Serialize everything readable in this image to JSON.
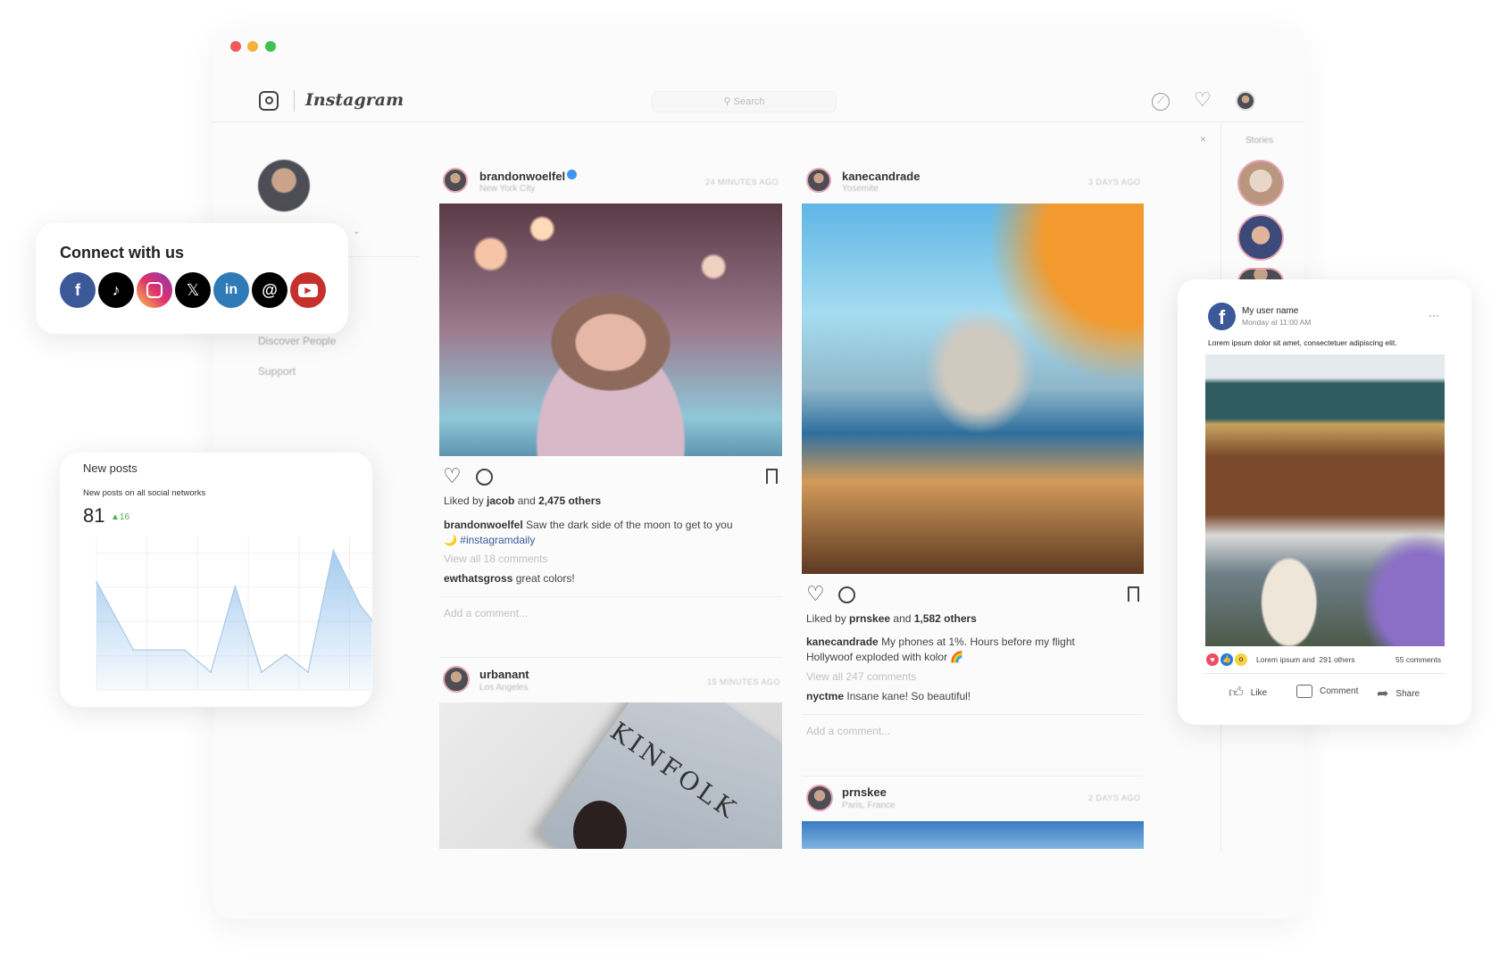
{
  "window": {
    "traffic_lights": [
      "#ee5b5b",
      "#f6b13a",
      "#3fc14f"
    ]
  },
  "instagram": {
    "wordmark": "Instagram",
    "search_placeholder": "Search",
    "sidebar": {
      "items": [
        "Discover People",
        "Support"
      ]
    },
    "stories_label": "Stories",
    "close_label": "×",
    "add_comment_placeholder": "Add a comment...",
    "posts": [
      {
        "user": "brandonwoelfel",
        "verified": true,
        "location": "New York City",
        "time": "24 MINUTES AGO",
        "liked_by": "jacob",
        "likes": "2,475 others",
        "caption_user": "brandonwoelfel",
        "caption": "Saw the dark side of the moon to get to you 🌙",
        "hashtag": "#instagramdaily",
        "view_all": "View all 18 comments",
        "comment_user": "ewthatsgross",
        "comment": "great colors!"
      },
      {
        "user": "kanecandrade",
        "location": "Yosemite",
        "time": "3 DAYS AGO",
        "liked_by": "prnskee",
        "likes": "1,582 others",
        "caption_user": "kanecandrade",
        "caption": "My phones at 1%. Hours before my flight Hollywoof exploded with kolor 🌈",
        "view_all": "View all 247 comments",
        "comment_user": "nyctme",
        "comment": "Insane kane! So beautiful!"
      },
      {
        "user": "urbanant",
        "location": "Los Angeles",
        "time": "15 MINUTES AGO",
        "image_text": "KINFOLK"
      },
      {
        "user": "prnskee",
        "location": "Paris, France",
        "time": "2 DAYS AGO"
      }
    ],
    "liked_by_prefix": "Liked by",
    "and_word": "and"
  },
  "connect": {
    "title": "Connect with us",
    "networks": [
      "facebook",
      "tiktok",
      "instagram",
      "x",
      "linkedin",
      "threads",
      "youtube"
    ]
  },
  "facebook_post": {
    "user": "My user name",
    "time": "Monday at 11:00 AM",
    "text": "Lorem ipsum dolor sit amet, consectetuer adipiscing elit.",
    "reactions": "Lorem ipsum and  291 others",
    "comments": "55 comments",
    "actions": [
      "Like",
      "Comment",
      "Share"
    ],
    "more": "···"
  },
  "new_posts": {
    "title": "New posts",
    "subtitle": "New posts on all social networks",
    "value": "81",
    "delta": "16",
    "delta_color": "#4caf50"
  },
  "chart_data": {
    "type": "area",
    "title": "New posts",
    "xlabel": "",
    "ylabel": "",
    "x": [
      0,
      0.73,
      1.74,
      2.26,
      2.74,
      3.26,
      3.74,
      4.18,
      4.68,
      5.21,
      5.44
    ],
    "values": [
      3.17,
      1.17,
      1.17,
      0.52,
      3.04,
      0.52,
      1.04,
      0.52,
      4.09,
      2.48,
      2.05
    ],
    "ylim": [
      0,
      4.5
    ],
    "grid": true,
    "color": "#9cc6ee"
  }
}
